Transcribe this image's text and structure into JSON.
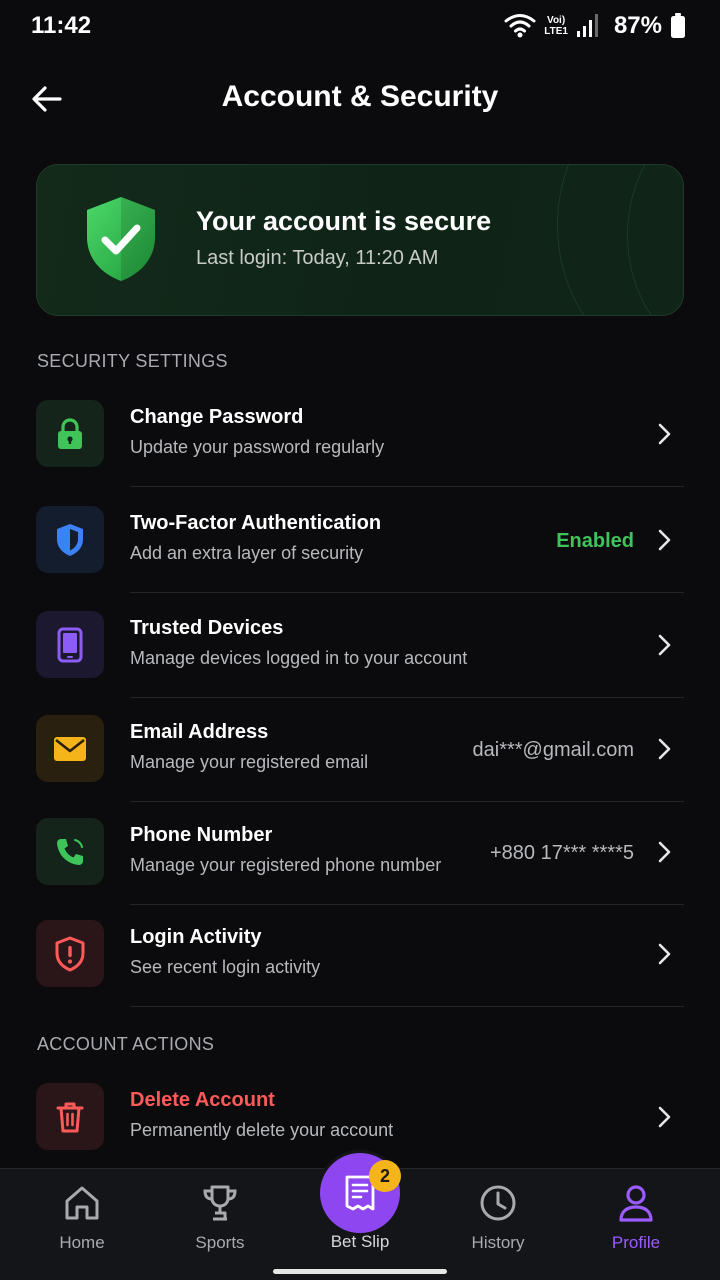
{
  "status_bar": {
    "time": "11:42",
    "network_top": "Voi)",
    "network_bottom": "LTE1",
    "battery": "87%"
  },
  "header": {
    "title": "Account & Security"
  },
  "secure_card": {
    "title": "Your account is secure",
    "subtitle": "Last login: Today, 11:20 AM",
    "accent": "#3fc45a"
  },
  "security_section": {
    "label": "SECURITY SETTINGS",
    "items": [
      {
        "title": "Change Password",
        "subtitle": "Update your password regularly",
        "value": "",
        "icon": "lock-icon",
        "tile": "#15241a",
        "color": "#3fc45a"
      },
      {
        "title": "Two-Factor Authentication",
        "subtitle": "Add an extra layer of security",
        "value": "Enabled",
        "icon": "shield-icon",
        "tile": "#141d2e",
        "color": "#3b82f6"
      },
      {
        "title": "Trusted Devices",
        "subtitle": "Manage devices logged in to your account",
        "value": "",
        "icon": "phone-device-icon",
        "tile": "#1c1830",
        "color": "#8b5cf6"
      },
      {
        "title": "Email Address",
        "subtitle": "Manage your registered email",
        "value": "dai***@gmail.com",
        "icon": "envelope-icon",
        "tile": "#2a2010",
        "color": "#f6b41b"
      },
      {
        "title": "Phone Number",
        "subtitle": "Manage your registered phone number",
        "value": "+880 17*** ****5",
        "icon": "phone-call-icon",
        "tile": "#15241a",
        "color": "#3fc45a"
      },
      {
        "title": "Login Activity",
        "subtitle": "See recent login activity",
        "value": "",
        "icon": "alert-shield-icon",
        "tile": "#2a1518",
        "color": "#ff5a5a"
      }
    ]
  },
  "account_section": {
    "label": "ACCOUNT ACTIONS",
    "items": [
      {
        "title": "Delete Account",
        "subtitle": "Permanently delete your account",
        "icon": "trash-icon",
        "tile": "#2a1518",
        "color": "#ff5a5a"
      }
    ]
  },
  "bottom_nav": {
    "items": [
      {
        "label": "Home",
        "icon": "home-icon"
      },
      {
        "label": "Sports",
        "icon": "trophy-icon"
      },
      {
        "label": "Bet Slip",
        "icon": "betslip-icon",
        "badge": "2"
      },
      {
        "label": "History",
        "icon": "clock-icon"
      },
      {
        "label": "Profile",
        "icon": "user-icon",
        "active": true
      }
    ],
    "accent": "#9b5cff"
  }
}
